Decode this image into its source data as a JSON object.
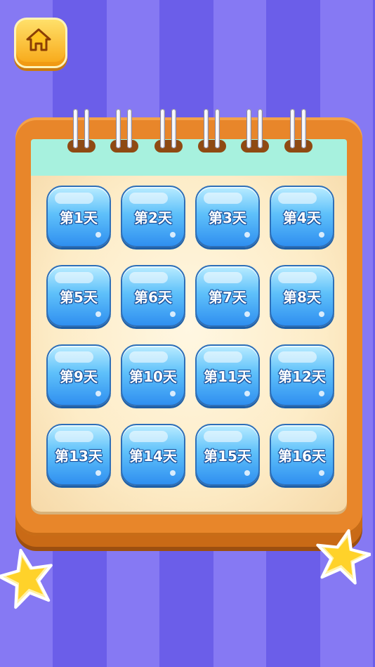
{
  "home_button": {
    "icon": "home-icon"
  },
  "calendar": {
    "days": [
      {
        "label": "第1天"
      },
      {
        "label": "第2天"
      },
      {
        "label": "第3天"
      },
      {
        "label": "第4天"
      },
      {
        "label": "第5天"
      },
      {
        "label": "第6天"
      },
      {
        "label": "第7天"
      },
      {
        "label": "第8天"
      },
      {
        "label": "第9天"
      },
      {
        "label": "第10天"
      },
      {
        "label": "第11天"
      },
      {
        "label": "第12天"
      },
      {
        "label": "第13天"
      },
      {
        "label": "第14天"
      },
      {
        "label": "第15天"
      },
      {
        "label": "第16天"
      }
    ]
  },
  "decorations": {
    "left_star": "star-icon",
    "right_star": "star-icon"
  },
  "colors": {
    "background_light": "#8679f3",
    "background_dark": "#6b5ee9",
    "frame_orange": "#e8862a",
    "mint": "#a7f1de",
    "button_blue": "#5fc1fa"
  }
}
